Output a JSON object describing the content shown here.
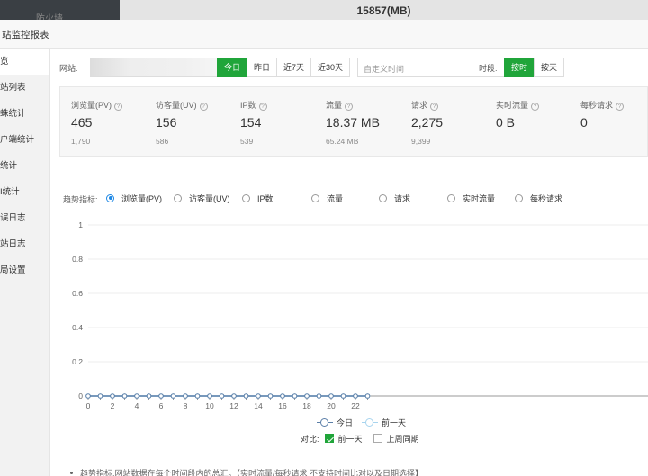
{
  "background": {
    "sidebar_text": "防火墙",
    "header_value": "15857(MB)"
  },
  "dialog": {
    "title": "站监控报表"
  },
  "sidebar": {
    "items": [
      {
        "label": "览",
        "active": true
      },
      {
        "label": "站列表"
      },
      {
        "label": "蛛统计"
      },
      {
        "label": "户端统计"
      },
      {
        "label": "统计"
      },
      {
        "label": "I统计"
      },
      {
        "label": "误日志"
      },
      {
        "label": "站日志"
      },
      {
        "label": "局设置"
      }
    ]
  },
  "toolbar": {
    "site_label": "网站:",
    "site_value": "",
    "range_buttons": [
      {
        "label": "今日",
        "active": true
      },
      {
        "label": "昨日"
      },
      {
        "label": "近7天"
      },
      {
        "label": "近30天"
      }
    ],
    "custom_time_placeholder": "自定义时间",
    "period_label": "时段:",
    "period_buttons": [
      {
        "label": "按时",
        "active": true
      },
      {
        "label": "按天"
      }
    ]
  },
  "stats": [
    {
      "label": "浏览量(PV)",
      "value": "465",
      "sub": "1,790"
    },
    {
      "label": "访客量(UV)",
      "value": "156",
      "sub": "586"
    },
    {
      "label": "IP数",
      "value": "154",
      "sub": "539"
    },
    {
      "label": "流量",
      "value": "18.37 MB",
      "sub": "65.24 MB"
    },
    {
      "label": "请求",
      "value": "2,275",
      "sub": "9,399"
    },
    {
      "label": "实时流量",
      "value": "0 B",
      "sub": ""
    },
    {
      "label": "每秒请求",
      "value": "0",
      "sub": ""
    }
  ],
  "metrics": {
    "title": "趋势指标:",
    "options": [
      {
        "label": "浏览量(PV)",
        "selected": true
      },
      {
        "label": "访客量(UV)"
      },
      {
        "label": "IP数"
      },
      {
        "label": "流量"
      },
      {
        "label": "请求"
      },
      {
        "label": "实时流量"
      },
      {
        "label": "每秒请求"
      }
    ]
  },
  "chart_data": {
    "type": "line",
    "title": "",
    "xlabel": "",
    "ylabel": "",
    "x": [
      0,
      1,
      2,
      3,
      4,
      5,
      6,
      7,
      8,
      9,
      10,
      11,
      12,
      13,
      14,
      15,
      16,
      17,
      18,
      19,
      20,
      21,
      22,
      23
    ],
    "x_tick_labels": [
      "0",
      "2",
      "4",
      "6",
      "8",
      "10",
      "12",
      "14",
      "16",
      "18",
      "20",
      "22"
    ],
    "y_tick_labels": [
      "0",
      "0.2",
      "0.4",
      "0.6",
      "0.8",
      "1"
    ],
    "ylim": [
      0,
      1
    ],
    "grid": true,
    "series": [
      {
        "name": "今日",
        "color": "#5b7fa8",
        "values": [
          0,
          0,
          0,
          0,
          0,
          0,
          0,
          0,
          0,
          0,
          0,
          0,
          0,
          0,
          0,
          0,
          0,
          0,
          0,
          0,
          0,
          0,
          0,
          0
        ]
      },
      {
        "name": "前一天",
        "color": "#a8d4ee",
        "values": [
          0,
          0,
          0,
          0,
          0,
          0,
          0,
          0,
          0,
          0,
          0,
          0,
          0,
          0,
          0,
          0,
          0,
          0,
          0,
          0,
          0,
          0,
          0,
          0
        ]
      }
    ]
  },
  "compare": {
    "title": "对比:",
    "options": [
      {
        "label": "前一天",
        "checked": true
      },
      {
        "label": "上周同期",
        "checked": false
      }
    ]
  },
  "note": "趋势指标:网站数据在每个时间段内的总汇。【实时流量/每秒请求 不支持时间比对以及日期选择】"
}
